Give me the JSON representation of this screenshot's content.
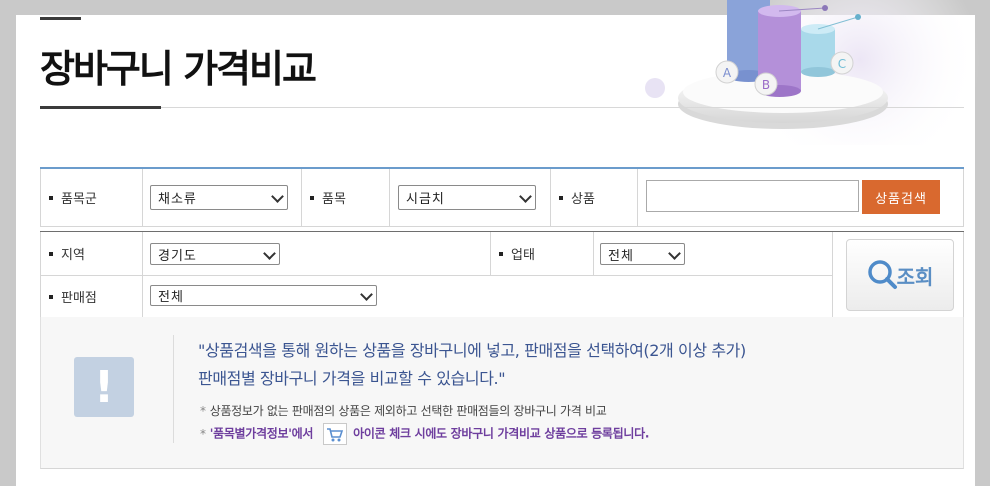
{
  "page": {
    "title": "장바구니 가격비교"
  },
  "decoration": {
    "bars": [
      "A",
      "B",
      "C"
    ]
  },
  "filters": {
    "category_group": {
      "label": "품목군",
      "value": "채소류"
    },
    "item": {
      "label": "품목",
      "value": "시금치"
    },
    "product": {
      "label": "상품",
      "value": "",
      "search_button": "상품검색"
    },
    "region": {
      "label": "지역",
      "value": "경기도"
    },
    "business_type": {
      "label": "업태",
      "value": "전체"
    },
    "store": {
      "label": "판매점",
      "value": "전체"
    },
    "query_button": "조회"
  },
  "info": {
    "line1": "\"상품검색을 통해 원하는 상품을 장바구니에 넣고, 판매점을 선택하여(2개 이상 추가)",
    "line2": "판매점별 장바구니 가격을 비교할 수 있습니다.\"",
    "note1": "상품정보가 없는 판매점의 상품은 제외하고 선택한 판매점들의 장바구니 가격 비교",
    "note2_link": "'품목별가격정보'에서",
    "note2_rest": "아이콘 체크 시에도 장바구니 가격비교 상품으로 등록됩니다.",
    "star": "*",
    "alert_glyph": "!"
  },
  "colors": {
    "accent": "#d9692f",
    "title_blue": "#3b5591",
    "link_purple": "#6e3e9e",
    "border_blue": "#6b9ccc"
  }
}
